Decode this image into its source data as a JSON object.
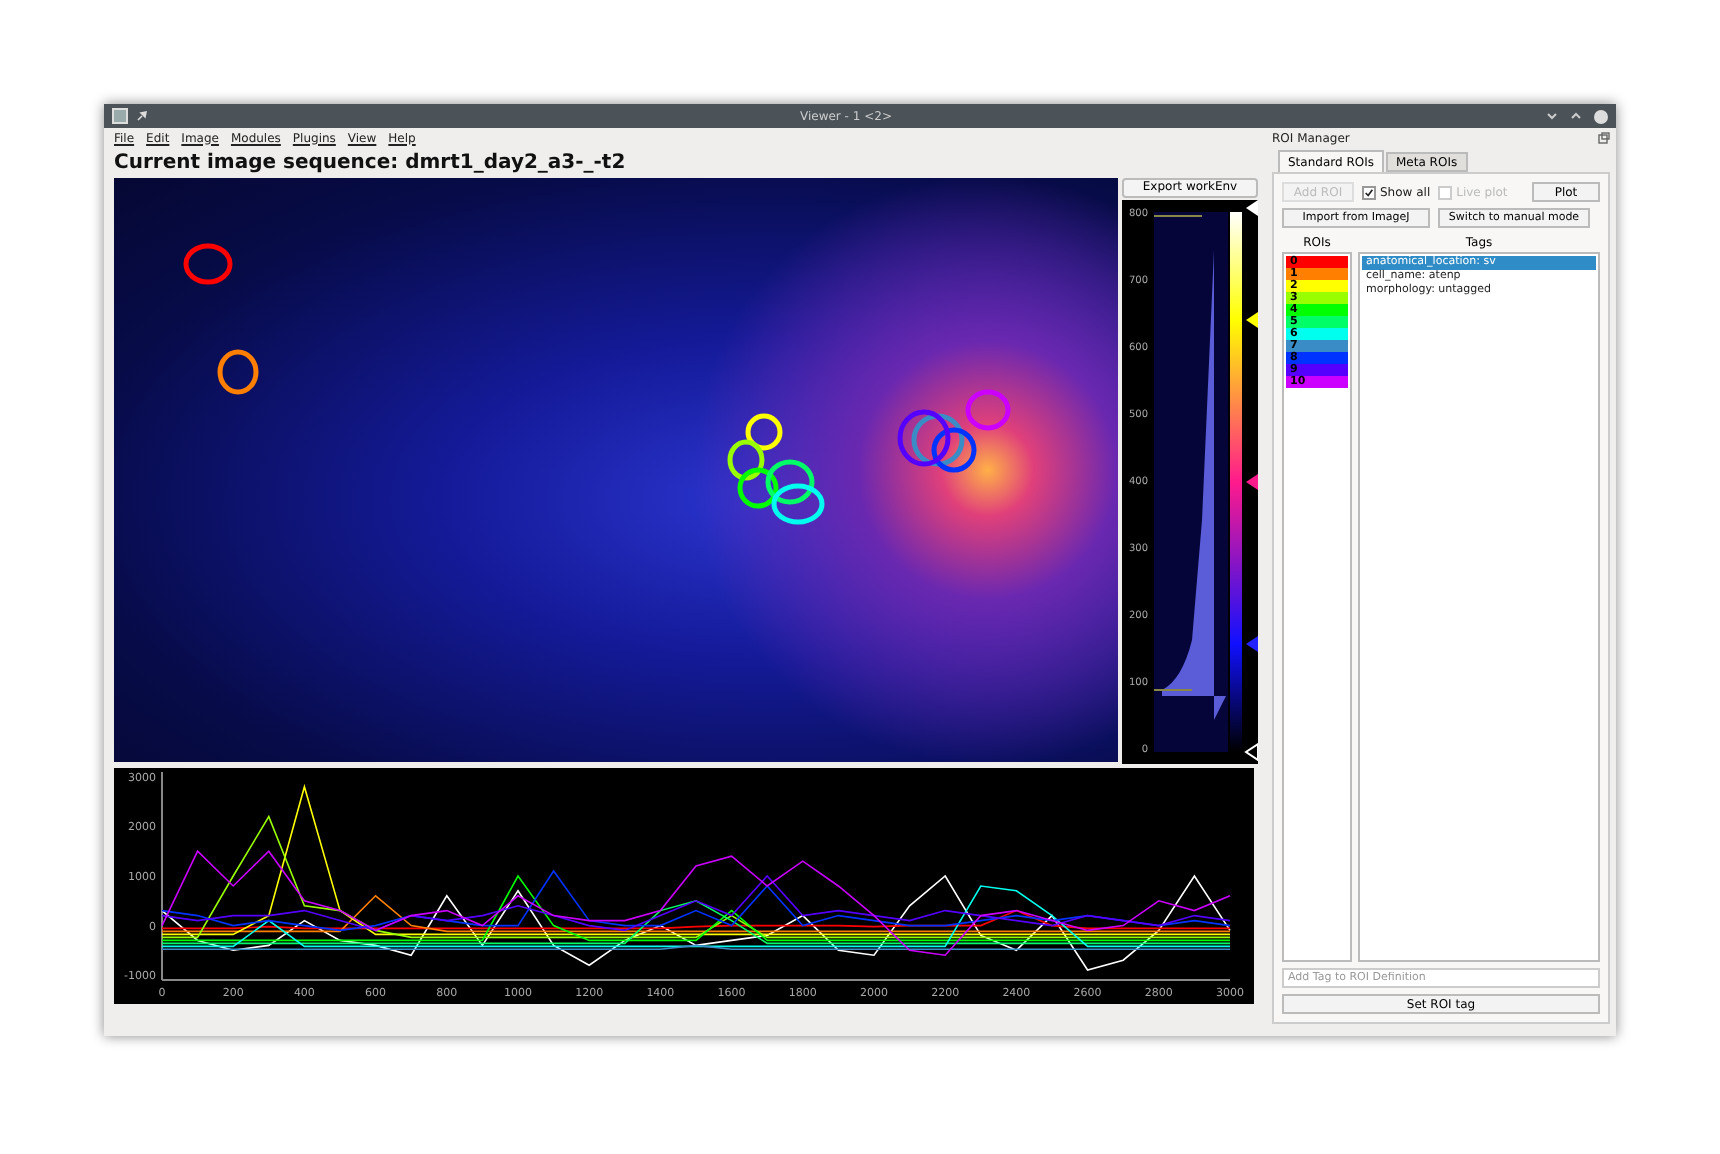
{
  "window": {
    "title": "Viewer - 1 <2>"
  },
  "menu": [
    "File",
    "Edit",
    "Image",
    "Modules",
    "Plugins",
    "View",
    "Help"
  ],
  "heading": "Current image sequence: dmrt1_day2_a3-_-t2",
  "export_button": "Export workEnv",
  "histogram": {
    "yticks": [
      "800",
      "700",
      "600",
      "500",
      "400",
      "300",
      "200",
      "100",
      "0"
    ]
  },
  "trace_plot": {
    "chart_data": {
      "type": "line",
      "x": [
        0,
        100,
        200,
        300,
        400,
        500,
        600,
        700,
        800,
        900,
        1000,
        1100,
        1200,
        1300,
        1400,
        1500,
        1600,
        1700,
        1800,
        1900,
        2000,
        2100,
        2200,
        2300,
        2400,
        2500,
        2600,
        2700,
        2800,
        2900,
        3000
      ],
      "xlim": [
        0,
        3000
      ],
      "ylim": [
        -1100,
        3100
      ],
      "xticks": [
        0,
        200,
        400,
        600,
        800,
        1000,
        1200,
        1400,
        1600,
        1800,
        2000,
        2200,
        2400,
        2600,
        2800,
        3000
      ],
      "yticks": [
        3000,
        2000,
        1000,
        0,
        -1000
      ],
      "series": [
        {
          "color": "#ffffff",
          "values": [
            300,
            -300,
            -500,
            -400,
            100,
            -300,
            -400,
            -600,
            600,
            -400,
            700,
            -400,
            -800,
            -300,
            0,
            -400,
            -300,
            -200,
            200,
            -500,
            -600,
            400,
            1000,
            -200,
            -500,
            200,
            -900,
            -700,
            -100,
            1000,
            -100
          ]
        },
        {
          "color": "#ff0000",
          "values": [
            -60,
            -60,
            -60,
            -20,
            -60,
            -60,
            -60,
            -60,
            -60,
            -60,
            -60,
            -60,
            -60,
            -60,
            -60,
            -20,
            0,
            0,
            0,
            0,
            -20,
            0,
            0,
            0,
            300,
            0,
            -60,
            -60,
            -60,
            -60,
            -60
          ]
        },
        {
          "color": "#ff7f00",
          "values": [
            -120,
            -120,
            -120,
            -120,
            -120,
            -120,
            600,
            0,
            -120,
            -120,
            -120,
            -120,
            -120,
            -120,
            -120,
            -120,
            -120,
            -120,
            -120,
            -120,
            -120,
            -120,
            -120,
            -120,
            -120,
            -120,
            -120,
            -120,
            -120,
            -120,
            -120
          ]
        },
        {
          "color": "#ffff00",
          "values": [
            -180,
            -180,
            -180,
            200,
            2800,
            300,
            -180,
            -180,
            -180,
            -180,
            -180,
            -180,
            -180,
            -180,
            -180,
            -180,
            -180,
            -180,
            -180,
            -180,
            -180,
            -180,
            -180,
            -180,
            -180,
            -180,
            -180,
            -180,
            -180,
            -180,
            -180
          ]
        },
        {
          "color": "#99ff00",
          "values": [
            -240,
            -240,
            1000,
            2200,
            400,
            300,
            -100,
            -240,
            -240,
            -240,
            -240,
            -240,
            -240,
            -240,
            -240,
            -240,
            200,
            -240,
            -240,
            -240,
            -240,
            -240,
            -240,
            -240,
            -240,
            -240,
            -240,
            -240,
            -240,
            -240,
            -240
          ]
        },
        {
          "color": "#00ff00",
          "values": [
            -300,
            -300,
            -300,
            -300,
            -300,
            -300,
            -300,
            -300,
            -300,
            -300,
            1000,
            0,
            -300,
            -300,
            -300,
            -300,
            300,
            -300,
            -300,
            -300,
            -300,
            -300,
            -300,
            -300,
            -300,
            -300,
            -300,
            -300,
            -300,
            -300,
            -300
          ]
        },
        {
          "color": "#00ff66",
          "values": [
            -360,
            -360,
            -360,
            -360,
            -360,
            -360,
            -360,
            -360,
            -360,
            -360,
            -360,
            -360,
            -360,
            -360,
            300,
            500,
            100,
            -360,
            -360,
            -360,
            -360,
            -360,
            -360,
            -360,
            -360,
            -360,
            -360,
            -360,
            -360,
            -360,
            -360
          ]
        },
        {
          "color": "#00ffee",
          "values": [
            -420,
            -420,
            -420,
            100,
            -420,
            -420,
            -420,
            -420,
            -420,
            -420,
            -420,
            -420,
            -420,
            -420,
            -420,
            -420,
            -420,
            -420,
            -420,
            -420,
            -420,
            -420,
            -420,
            800,
            700,
            200,
            -420,
            -420,
            -420,
            -420,
            -420
          ]
        },
        {
          "color": "#3a8cc6",
          "values": [
            -480,
            -480,
            -480,
            -480,
            -480,
            -480,
            -480,
            -480,
            -480,
            -480,
            -480,
            -480,
            -480,
            -480,
            -480,
            -400,
            -480,
            -480,
            -480,
            -480,
            -480,
            -480,
            -480,
            -480,
            -480,
            -480,
            -480,
            -480,
            -480,
            -480,
            -480
          ]
        },
        {
          "color": "#0033ff",
          "values": [
            300,
            200,
            0,
            100,
            0,
            -100,
            0,
            200,
            100,
            0,
            0,
            1100,
            100,
            0,
            0,
            300,
            0,
            800,
            0,
            200,
            100,
            0,
            0,
            100,
            200,
            100,
            200,
            100,
            0,
            100,
            0
          ]
        },
        {
          "color": "#5500ff",
          "values": [
            200,
            100,
            200,
            200,
            300,
            100,
            -100,
            200,
            100,
            200,
            400,
            200,
            0,
            -100,
            200,
            500,
            200,
            1000,
            200,
            300,
            200,
            100,
            300,
            200,
            100,
            0,
            200,
            100,
            0,
            200,
            100
          ]
        },
        {
          "color": "#cc00ff",
          "values": [
            0,
            1500,
            800,
            1500,
            500,
            300,
            -100,
            200,
            300,
            0,
            600,
            200,
            100,
            100,
            300,
            1200,
            1400,
            800,
            1300,
            800,
            200,
            -500,
            -600,
            200,
            300,
            100,
            -100,
            0,
            500,
            300,
            600
          ]
        }
      ]
    }
  },
  "roi_manager": {
    "title": "ROI Manager",
    "tabs": [
      {
        "label": "Standard ROIs",
        "selected": true
      },
      {
        "label": "Meta ROIs",
        "selected": false
      }
    ],
    "add_roi": {
      "label": "Add ROI",
      "disabled": true
    },
    "show_all": {
      "label": "Show all",
      "checked": true
    },
    "live_plot": {
      "label": "Live plot",
      "checked": false,
      "disabled": true
    },
    "plot_button": "Plot",
    "import_button": "Import from ImageJ",
    "manual_button": "Switch to manual mode",
    "rois_header": "ROIs",
    "tags_header": "Tags",
    "rois": [
      {
        "label": "0",
        "color": "#ff0000"
      },
      {
        "label": "1",
        "color": "#ff7f00"
      },
      {
        "label": "2",
        "color": "#ffff00"
      },
      {
        "label": "3",
        "color": "#99ff00"
      },
      {
        "label": "4",
        "color": "#00ff00"
      },
      {
        "label": "5",
        "color": "#00ff66"
      },
      {
        "label": "6",
        "color": "#00ffee"
      },
      {
        "label": "7",
        "color": "#3a8cc6"
      },
      {
        "label": "8",
        "color": "#0033ff"
      },
      {
        "label": "9",
        "color": "#5500ff"
      },
      {
        "label": "10",
        "color": "#cc00ff"
      }
    ],
    "tags": [
      {
        "text": "anatomical_location: sv",
        "selected": true
      },
      {
        "text": "cell_name: atenp",
        "selected": false
      },
      {
        "text": "morphology: untagged",
        "selected": false
      }
    ],
    "tag_input": {
      "placeholder": "Add Tag to ROI Definition"
    },
    "set_tag_button": "Set ROI tag"
  }
}
